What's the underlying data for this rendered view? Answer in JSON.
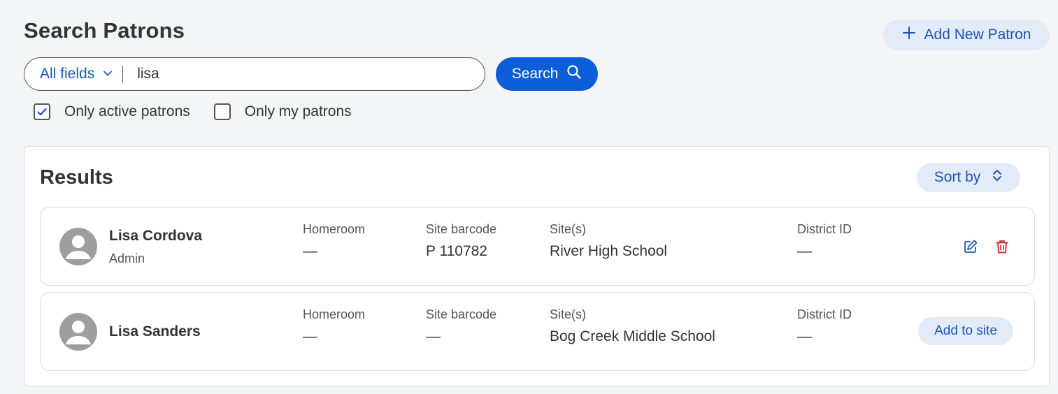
{
  "page": {
    "title": "Search Patrons",
    "add_patron_label": "Add New Patron"
  },
  "search": {
    "field_selector": "All fields",
    "query": "lisa",
    "button_label": "Search"
  },
  "filters": [
    {
      "label": "Only active patrons",
      "checked": true
    },
    {
      "label": "Only my patrons",
      "checked": false
    }
  ],
  "results": {
    "title": "Results",
    "sort_label": "Sort by",
    "columns": {
      "homeroom": "Homeroom",
      "site_barcode": "Site barcode",
      "sites": "Site(s)",
      "district_id": "District ID"
    },
    "rows": [
      {
        "name": "Lisa Cordova",
        "role": "Admin",
        "homeroom": "—",
        "site_barcode": "P 110782",
        "sites": "River High School",
        "district_id": "—",
        "actions": [
          "edit-icon",
          "trash-icon"
        ]
      },
      {
        "name": "Lisa Sanders",
        "role": "",
        "homeroom": "—",
        "site_barcode": "—",
        "sites": "Bog Creek Middle School",
        "district_id": "—",
        "action_label": "Add to site"
      }
    ]
  },
  "colors": {
    "primary": "#0b5ed7",
    "primary_text": "#1a56b8",
    "pill_bg": "#e3ebf8",
    "delete": "#c62828",
    "avatar": "#9e9e9e"
  }
}
